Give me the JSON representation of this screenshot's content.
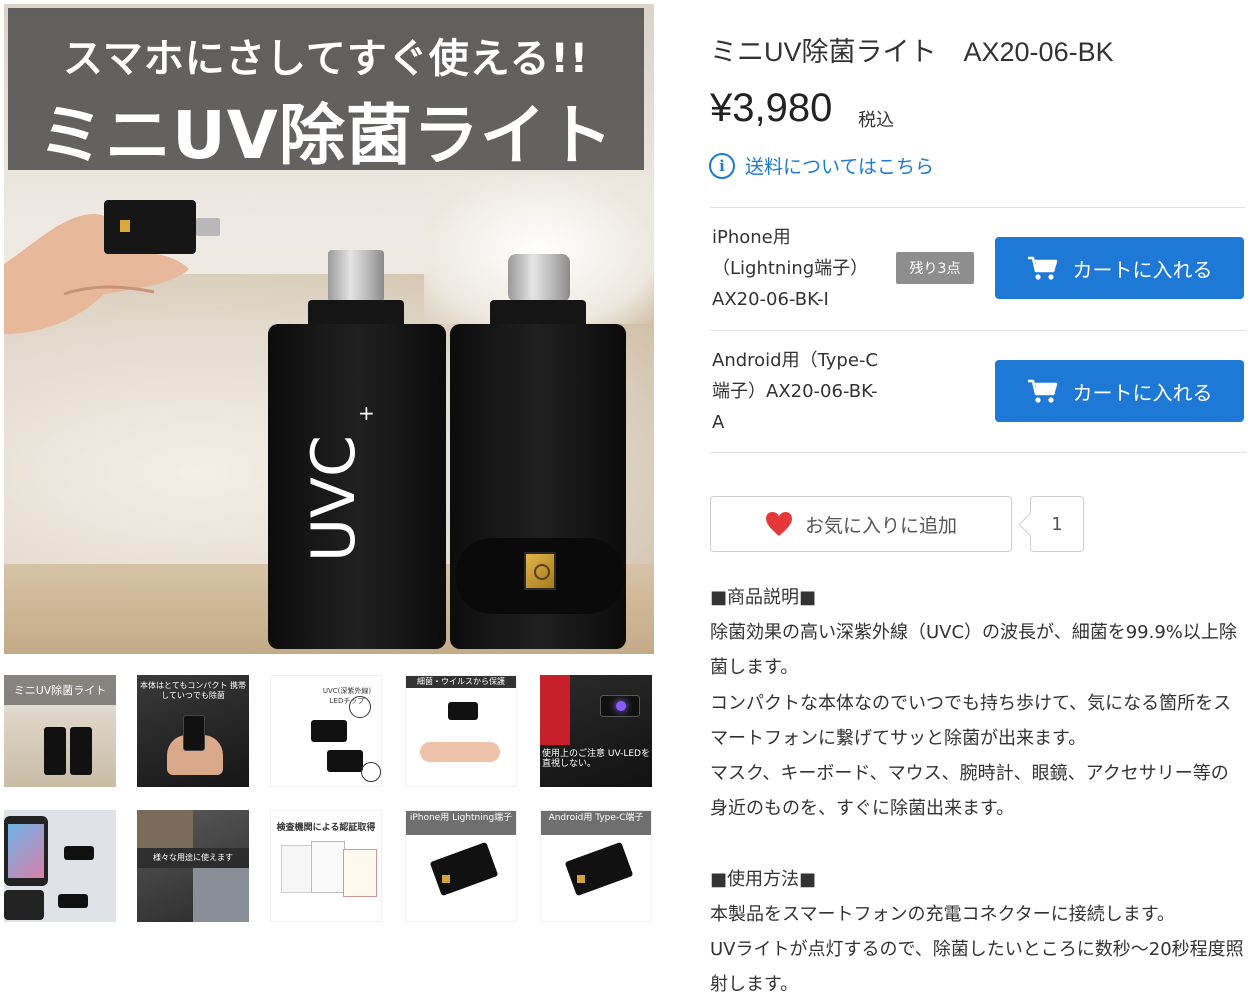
{
  "main_image": {
    "banner_line1": "スマホにさしてすぐ使える!!",
    "banner_line2": "ミニUV除菌ライト",
    "logo_text": "UVC"
  },
  "thumbnails": [
    {
      "caption": "ミニUV除菌ライト"
    },
    {
      "caption": "本体はとてもコンパクト 携帯していつでも除菌"
    },
    {
      "caption": "UVC(深紫外線) LEDチップ"
    },
    {
      "caption": "細菌・ウイルスから保護"
    },
    {
      "caption": "使用上のご注意 UV-LEDを直視しない。"
    },
    {
      "caption": ""
    },
    {
      "caption": "様々な用途に使えます"
    },
    {
      "caption": "検査機関による認証取得"
    },
    {
      "caption": "iPhone用 Lightning端子"
    },
    {
      "caption": "Android用 Type-C端子"
    }
  ],
  "product": {
    "title": "ミニUV除菌ライト　AX20-06-BK",
    "price": "¥3,980",
    "tax_label": "税込",
    "shipping_link": "送料についてはこちら"
  },
  "variants": [
    {
      "name": "iPhone用（Lightning端子）AX20-06-BK-I",
      "stock_badge": "残り3点",
      "cart_label": "カートに入れる"
    },
    {
      "name": "Android用（Type-C端子）AX20-06-BK-A",
      "stock_badge": "",
      "cart_label": "カートに入れる"
    }
  ],
  "favorite": {
    "label": "お気に入りに追加",
    "count": "1"
  },
  "description": {
    "heading1": "■商品説明■",
    "para1": "除菌効果の高い深紫外線（UVC）の波長が、細菌を99.9%以上除菌します。",
    "para2": "コンパクトな本体なのでいつでも持ち歩けて、気になる箇所をスマートフォンに繋げてサッと除菌が出来ます。",
    "para3": "マスク、キーボード、マウス、腕時計、眼鏡、アクセサリー等の身近のものを、すぐに除菌出来ます。",
    "heading2": "■使用方法■",
    "para4": "本製品をスマートフォンの充電コネクターに接続します。",
    "para5": "UVライトが点灯するので、除菌したいところに数秒～20秒程度照射します。"
  },
  "colors": {
    "accent": "#1d78d6",
    "link": "#1c79d6",
    "heart": "#e5383b",
    "badge": "#8e8e8e"
  }
}
